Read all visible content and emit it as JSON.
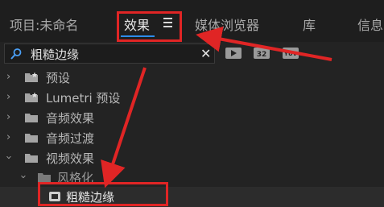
{
  "tabs": [
    {
      "label": "项目:未命名"
    },
    {
      "label": "效果"
    },
    {
      "label": "媒体浏览器"
    },
    {
      "label": "库"
    },
    {
      "label": "信息"
    }
  ],
  "search": {
    "value": "粗糙边缘"
  },
  "tree": [
    {
      "label": "预设",
      "icon": "preset-folder-icon"
    },
    {
      "label": "Lumetri 预设",
      "icon": "preset-folder-icon"
    },
    {
      "label": "音频效果",
      "icon": "folder-icon"
    },
    {
      "label": "音频过渡",
      "icon": "folder-icon"
    },
    {
      "label": "视频效果",
      "icon": "folder-icon"
    },
    {
      "label": "风格化",
      "icon": "folder-icon"
    },
    {
      "label": "粗糙边缘",
      "icon": "effect-icon"
    }
  ],
  "colors": {
    "accent": "#2d8ceb",
    "annotation": "#e02525",
    "background": "#232323"
  }
}
